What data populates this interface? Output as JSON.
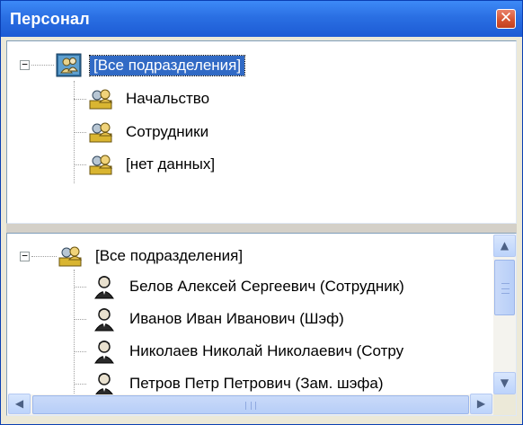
{
  "window": {
    "title": "Персонал",
    "close_label": "✕"
  },
  "departments_tree": {
    "root": {
      "label": "[Все подразделения]",
      "expander": "−",
      "icon": "departments-root-icon",
      "selected": true
    },
    "items": [
      {
        "label": "Начальство",
        "icon": "user-group-icon"
      },
      {
        "label": "Сотрудники",
        "icon": "user-group-icon"
      },
      {
        "label": "[нет данных]",
        "icon": "user-group-icon"
      }
    ]
  },
  "employees_tree": {
    "root": {
      "label": "[Все подразделения]",
      "expander": "−",
      "icon": "user-group-icon"
    },
    "items": [
      {
        "label": "Белов Алексей Сергеевич (Сотрудник)",
        "icon": "person-icon"
      },
      {
        "label": "Иванов Иван Иванович (Шэф)",
        "icon": "person-icon"
      },
      {
        "label": "Николаев Николай Николаевич (Сотру",
        "icon": "person-icon"
      },
      {
        "label": "Петров Петр Петрович (Зам. шэфа)",
        "icon": "person-icon"
      }
    ]
  },
  "scrollbars": {
    "up": "▲",
    "down": "▼",
    "left": "◀",
    "right": "▶"
  },
  "colors": {
    "titlebar": "#2a6fe3",
    "selection": "#316ac5",
    "close": "#d4522f"
  }
}
